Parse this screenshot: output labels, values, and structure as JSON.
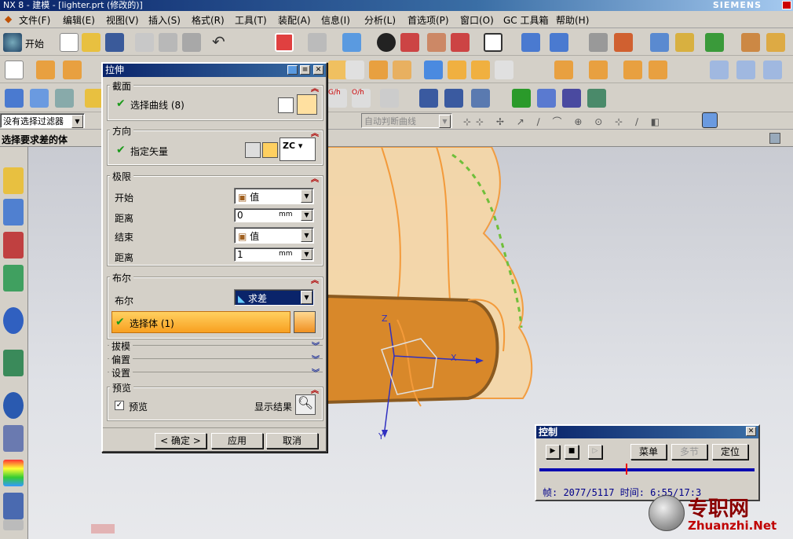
{
  "window": {
    "title": "NX 8 - 建模 - [lighter.prt (修改的)]",
    "brand": "SIEMENS"
  },
  "menu": [
    "文件(F)",
    "编辑(E)",
    "视图(V)",
    "插入(S)",
    "格式(R)",
    "工具(T)",
    "装配(A)",
    "信息(I)",
    "分析(L)",
    "首选项(P)",
    "窗口(O)",
    "GC 工具箱",
    "帮助(H)"
  ],
  "toolbar": {
    "start_label": "开始"
  },
  "filter": {
    "selection_filter": "没有选择过滤器",
    "curve_rule": "自动判断曲线",
    "cue": "选择要求差的体"
  },
  "dialog": {
    "title": "拉伸",
    "section": {
      "header": "截面",
      "select_curve": "选择曲线 (8)"
    },
    "direction": {
      "header": "方向",
      "specify_vector": "指定矢量",
      "vector_value": "ZC"
    },
    "limits": {
      "header": "极限",
      "start_label": "开始",
      "start_value": "值",
      "start_dist_label": "距离",
      "start_dist": "0",
      "start_unit": "mm",
      "end_label": "结束",
      "end_value": "值",
      "end_dist_label": "距离",
      "end_dist": "1",
      "end_unit": "mm"
    },
    "boolean": {
      "header": "布尔",
      "label": "布尔",
      "value": "求差",
      "select_body": "选择体 (1)"
    },
    "draft": {
      "header": "拔模"
    },
    "offset": {
      "header": "偏置"
    },
    "settings": {
      "header": "设置"
    },
    "preview": {
      "header": "预览",
      "preview_label": "预览",
      "show_result": "显示结果"
    },
    "buttons": {
      "ok": "< 确定 >",
      "apply": "应用",
      "cancel": "取消"
    }
  },
  "control": {
    "title": "控制",
    "menu_label": "菜单",
    "section_label": "多节",
    "locate_label": "定位",
    "status": "帧: 2077/5117 时间: 6:55/17:3",
    "progress": 0.4
  },
  "axes": {
    "x": "X",
    "y": "Y",
    "z": "Z"
  },
  "watermark": {
    "site": "Zhuanzhi.Net",
    "cn": "专职网"
  },
  "colors": {
    "accent": "#0a246a",
    "body_orange": "#d8882a",
    "shell": "#f5d7a8"
  }
}
